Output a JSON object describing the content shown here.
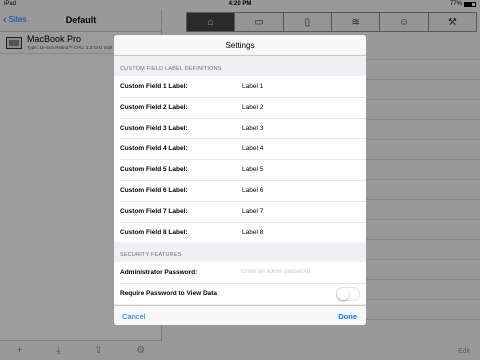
{
  "status_bar": {
    "carrier": "iPad",
    "wifi_icon": "wifi-icon",
    "time": "4:20 PM",
    "battery_text": "77%"
  },
  "master": {
    "back_label": "Sites",
    "title": "Default",
    "device": {
      "name": "MacBook Pro",
      "spec": "Type: 15-inch Retina™ CPU: 2.3 GHz Intel"
    },
    "toolbar_icons": [
      "add-icon",
      "download-icon",
      "share-icon",
      "settings-icon"
    ]
  },
  "detail": {
    "tabs": [
      {
        "icon": "home-icon",
        "glyph": "⌂"
      },
      {
        "icon": "monitor-icon",
        "glyph": "▭"
      },
      {
        "icon": "tablet-icon",
        "glyph": "▯"
      },
      {
        "icon": "wifi-icon",
        "glyph": "≋"
      },
      {
        "icon": "person-icon",
        "glyph": "☺"
      },
      {
        "icon": "tools-icon",
        "glyph": "⚒"
      }
    ],
    "edit_label": "Edit"
  },
  "settings": {
    "title": "Settings",
    "custom_section_header": "CUSTOM FIELD LABEL DEFINITIONS",
    "fields": [
      {
        "label": "Custom Field 1 Label:",
        "value": "Label 1"
      },
      {
        "label": "Custom Field 2 Label:",
        "value": "Label 2"
      },
      {
        "label": "Custom Field 3 Label:",
        "value": "Label 3"
      },
      {
        "label": "Custom Field 4 Label:",
        "value": "Label 4"
      },
      {
        "label": "Custom Field 5 Label:",
        "value": "Label 5"
      },
      {
        "label": "Custom Field 6 Label:",
        "value": "Label 6"
      },
      {
        "label": "Custom Field 7 Label:",
        "value": "Label 7"
      },
      {
        "label": "Custom Field 8 Label:",
        "value": "Label 8"
      }
    ],
    "security_section_header": "SECURITY FEATURES",
    "admin_password_label": "Administrator Password:",
    "admin_password_placeholder": "Enter an admin password.",
    "require_password_label": "Require Password to View Data",
    "cancel_label": "Cancel",
    "done_label": "Done"
  }
}
